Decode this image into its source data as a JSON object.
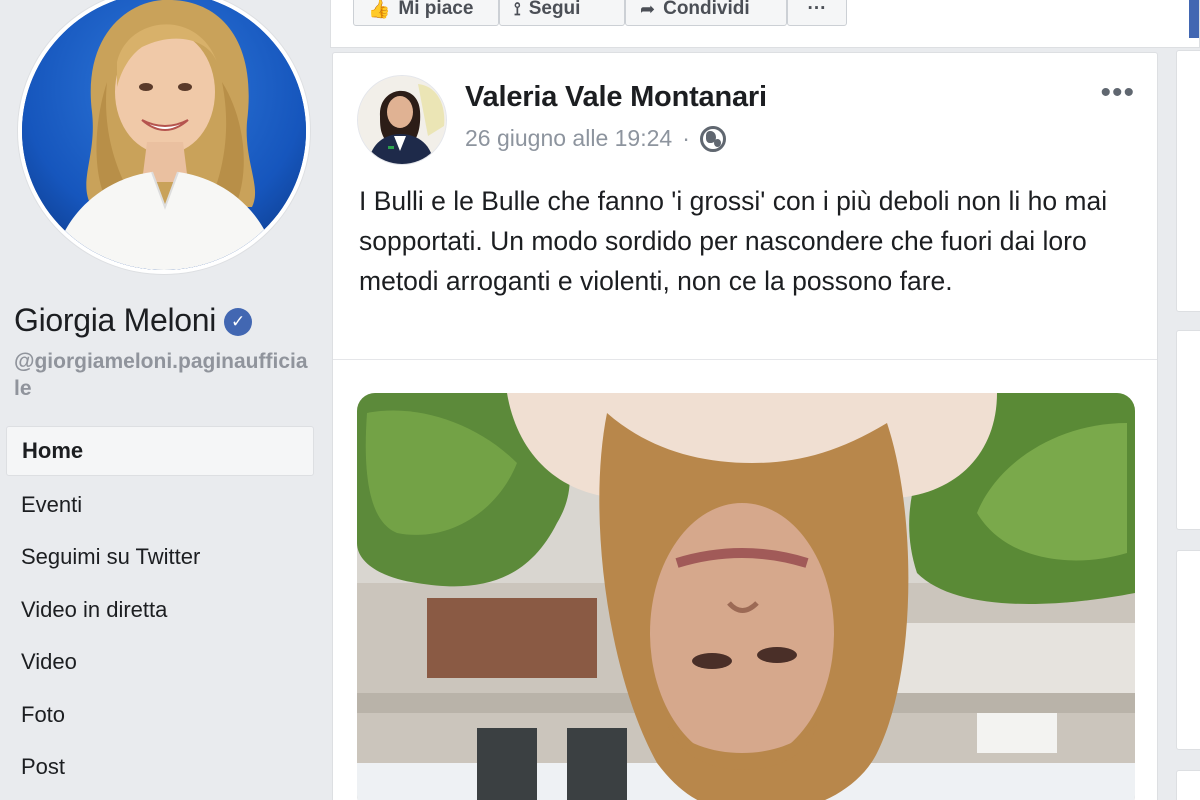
{
  "page": {
    "name": "Giorgia Meloni",
    "handle": "@giorgiameloni.paginaufficiale",
    "verified": true
  },
  "nav": {
    "items": [
      {
        "label": "Home",
        "active": true
      },
      {
        "label": "Eventi",
        "active": false
      },
      {
        "label": "Seguimi su Twitter",
        "active": false
      },
      {
        "label": "Video in diretta",
        "active": false
      },
      {
        "label": "Video",
        "active": false
      },
      {
        "label": "Foto",
        "active": false
      },
      {
        "label": "Post",
        "active": false
      }
    ]
  },
  "actions": {
    "like_label": "Mi piace",
    "follow_label": "Segui",
    "share_label": "Condividi",
    "more_label": "···"
  },
  "post": {
    "author": "Valeria Vale Montanari",
    "date": "26 giugno alle 19:24",
    "separator": "·",
    "audience_icon": "globe-icon",
    "more_label": "•••",
    "text": "I Bulli e le Bulle che fanno 'i grossi' con i più deboli non li ho mai sopportati. Un modo sordido per nascondere che fuori dai loro metodi arroganti e violenti, non ce la possono fare."
  },
  "colors": {
    "background": "#e9ebee",
    "brand": "#4267b2",
    "text": "#1c1e21",
    "muted": "#90949c"
  }
}
